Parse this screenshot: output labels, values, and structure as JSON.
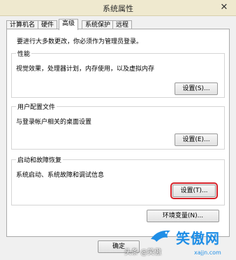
{
  "window": {
    "title": "系统属性",
    "close_glyph": "✕"
  },
  "tabs": [
    {
      "label": "计算机名",
      "active": false
    },
    {
      "label": "硬件",
      "active": false
    },
    {
      "label": "高级",
      "active": true
    },
    {
      "label": "系统保护",
      "active": false
    },
    {
      "label": "远程",
      "active": false
    }
  ],
  "advanced": {
    "admin_note": "要进行大多数更改，你必须作为管理员登录。",
    "performance": {
      "title": "性能",
      "description": "视觉效果，处理器计划，内存使用，以及虚拟内存",
      "button": "设置(S)..."
    },
    "user_profiles": {
      "title": "用户配置文件",
      "description": "与登录帐户相关的桌面设置",
      "button": "设置(E)..."
    },
    "startup_recovery": {
      "title": "启动和故障恢复",
      "description": "系统启动、系统故障和调试信息",
      "button": "设置(T)..."
    },
    "env_button": "环境变量(N)..."
  },
  "footer": {
    "ok_button": "确定"
  },
  "watermark": {
    "brand": "笑傲网",
    "sub": "头条 @笑傲",
    "url": "xajjn.com"
  },
  "colors": {
    "title_bar": "#efe9cf",
    "highlight": "#d4222a",
    "watermark_blue": "#1f8ee6"
  }
}
